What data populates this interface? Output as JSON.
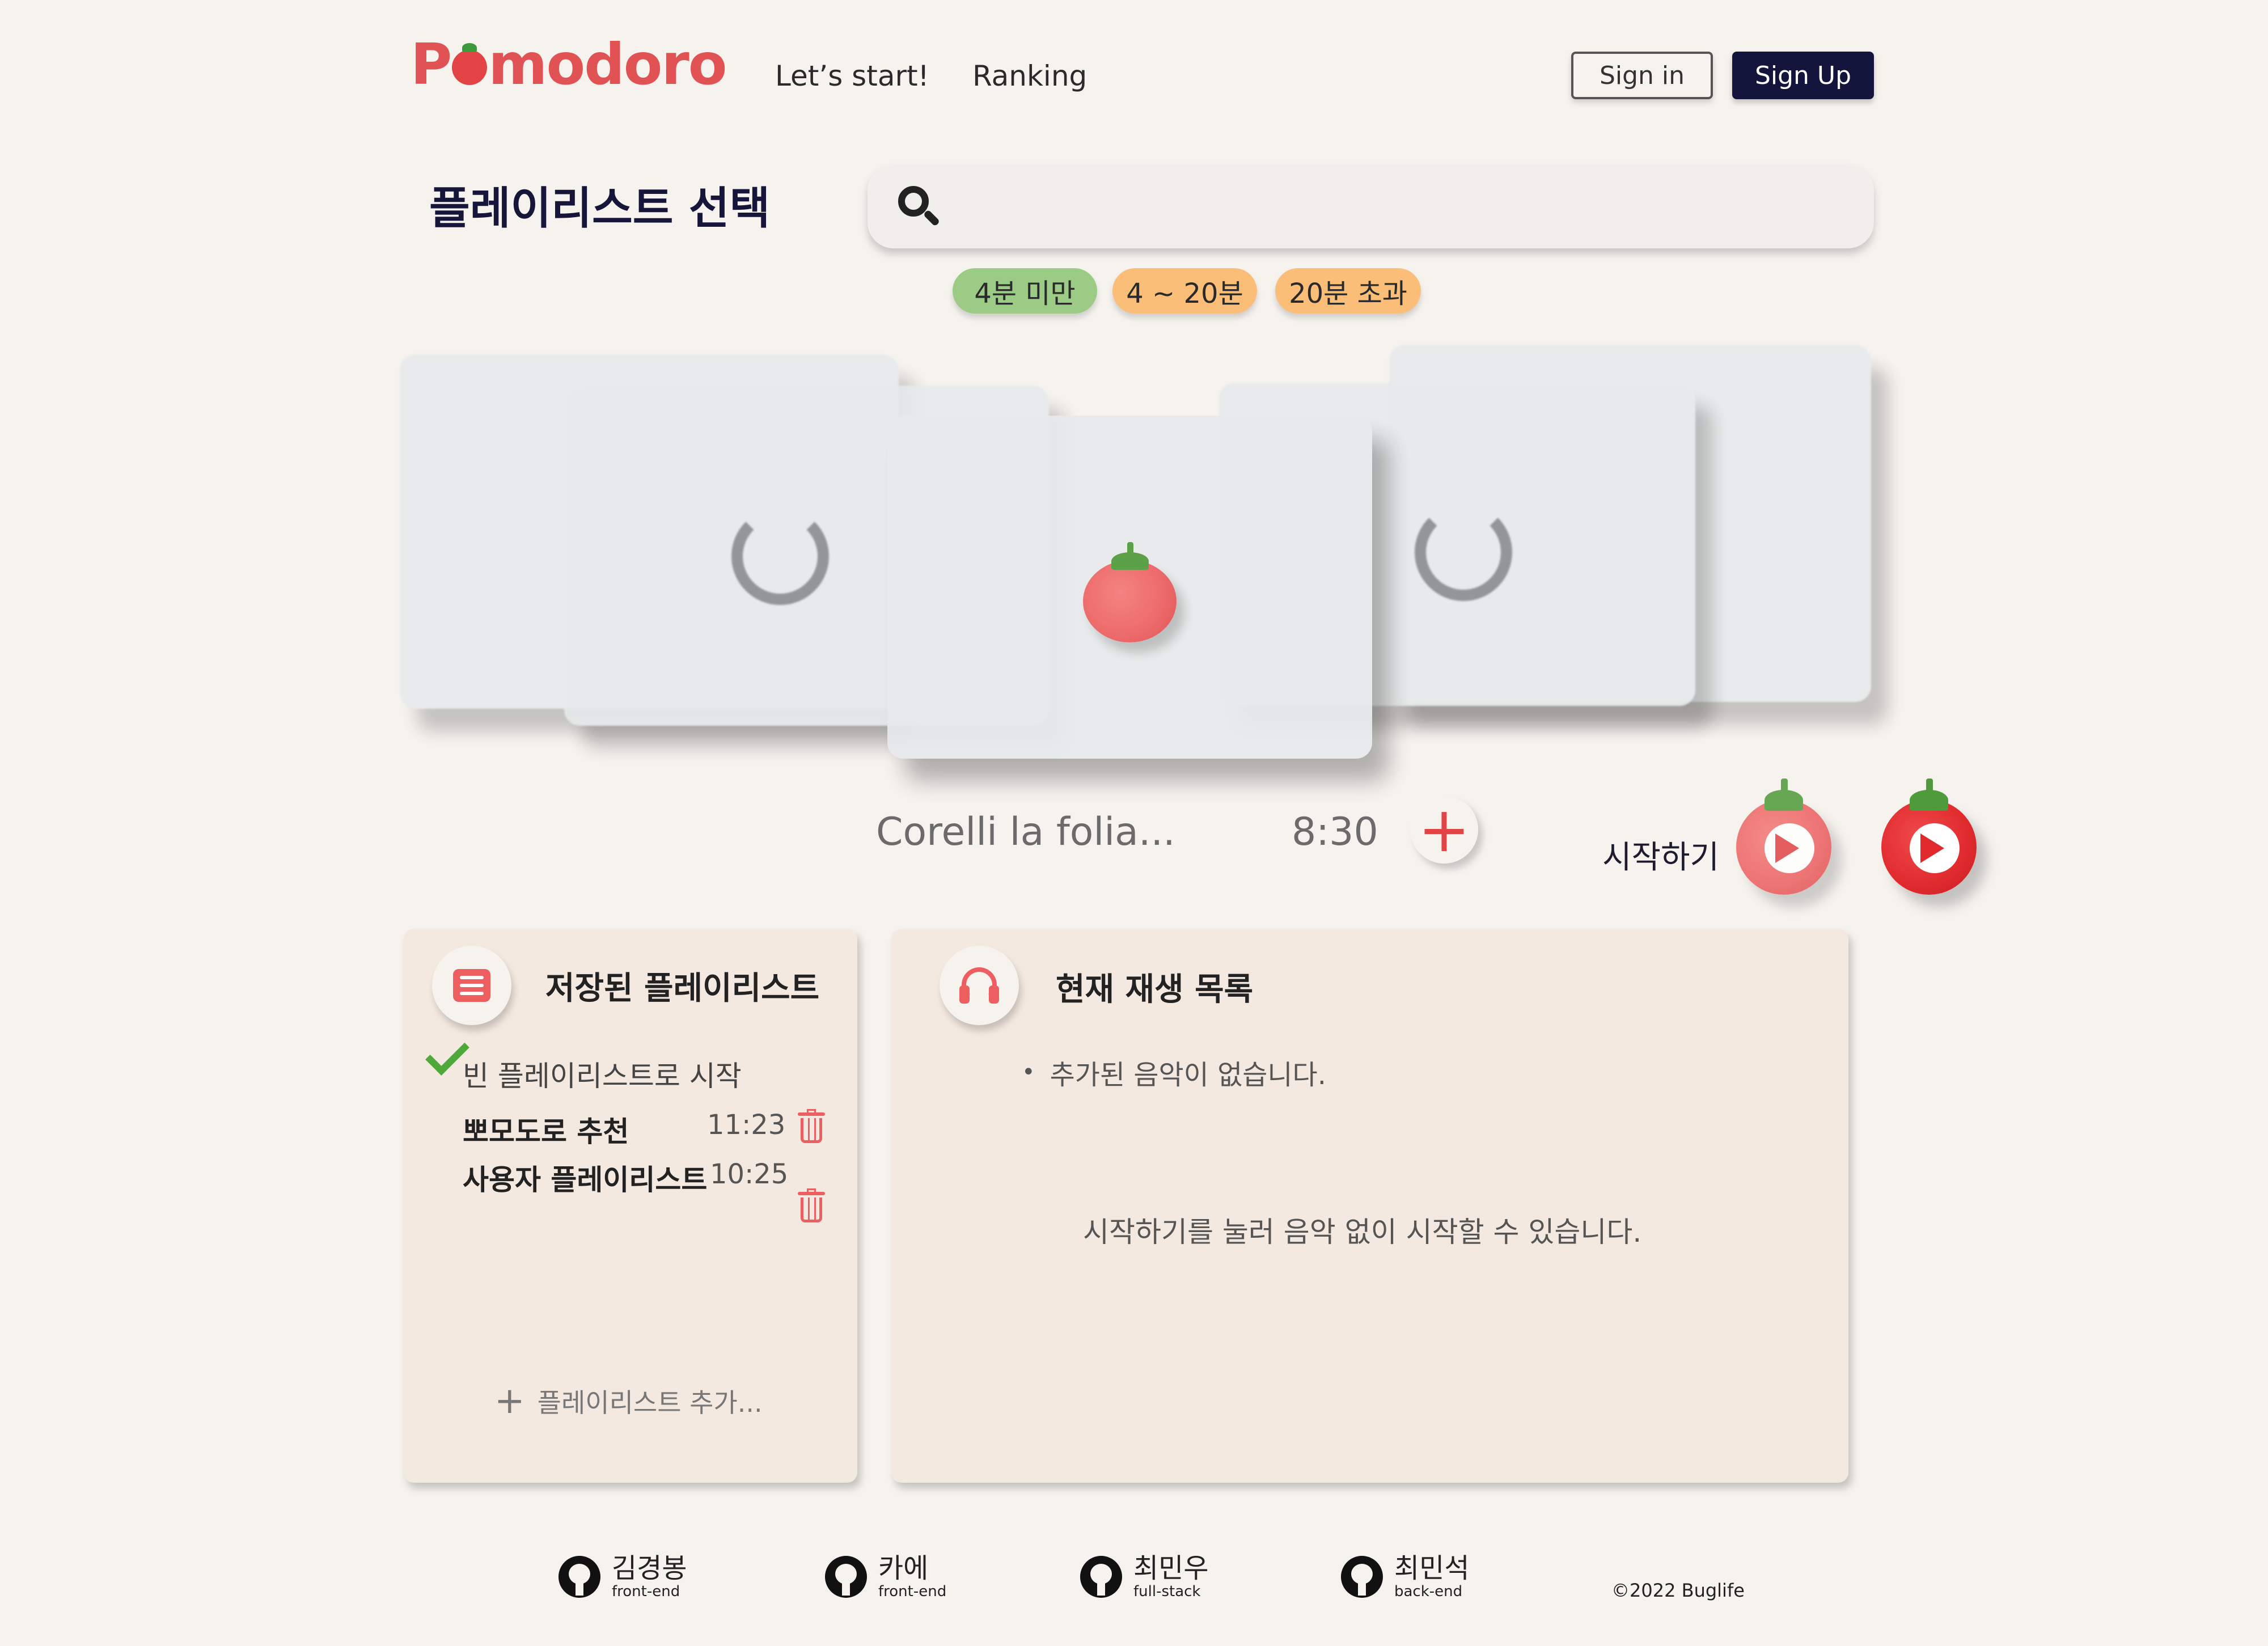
{
  "header": {
    "logo_prefix": "P",
    "logo_suffix": "modoro",
    "nav": [
      "Let’s start!",
      "Ranking"
    ],
    "sign_in": "Sign in",
    "sign_up": "Sign Up"
  },
  "main": {
    "title": "플레이리스트 선택",
    "search_placeholder": "",
    "filters": [
      "4분 미만",
      "4 ~ 20분",
      "20분 초과"
    ]
  },
  "current_track": {
    "title": "Corelli la folia...",
    "duration": "8:30",
    "add_label": "+"
  },
  "start": {
    "label": "시작하기"
  },
  "saved_panel": {
    "heading": "저장된 플레이리스트",
    "empty_start": "빈 플레이리스트로 시작",
    "items": [
      {
        "name": "뽀모도로 추천",
        "time": "11:23"
      },
      {
        "name": "사용자 플레이리스트",
        "time": "10:25"
      }
    ],
    "add_label": "플레이리스트 추가..."
  },
  "now_playing_panel": {
    "heading": "현재 재생 목록",
    "empty_message": "추가된 음악이 없습니다.",
    "hint": "시작하기를 눌러 음악 없이 시작할 수 있습니다."
  },
  "footer": {
    "developers": [
      {
        "name": "김경봉",
        "role": "front-end"
      },
      {
        "name": "카에",
        "role": "front-end"
      },
      {
        "name": "최민우",
        "role": "full-stack"
      },
      {
        "name": "최민석",
        "role": "back-end"
      }
    ],
    "copyright": "©2022 Buglife"
  },
  "colors": {
    "brand": "#e05254",
    "navy": "#13153d",
    "background": "#f6f3ef",
    "panel": "#f3e9e0",
    "chip_green": "#9ccb86",
    "chip_orange": "#fbbe78"
  },
  "icons": [
    "search-icon",
    "tomato-icon",
    "spinner-icon",
    "plus-icon",
    "play-icon",
    "list-icon",
    "headphones-icon",
    "check-icon",
    "trash-icon",
    "github-icon"
  ]
}
